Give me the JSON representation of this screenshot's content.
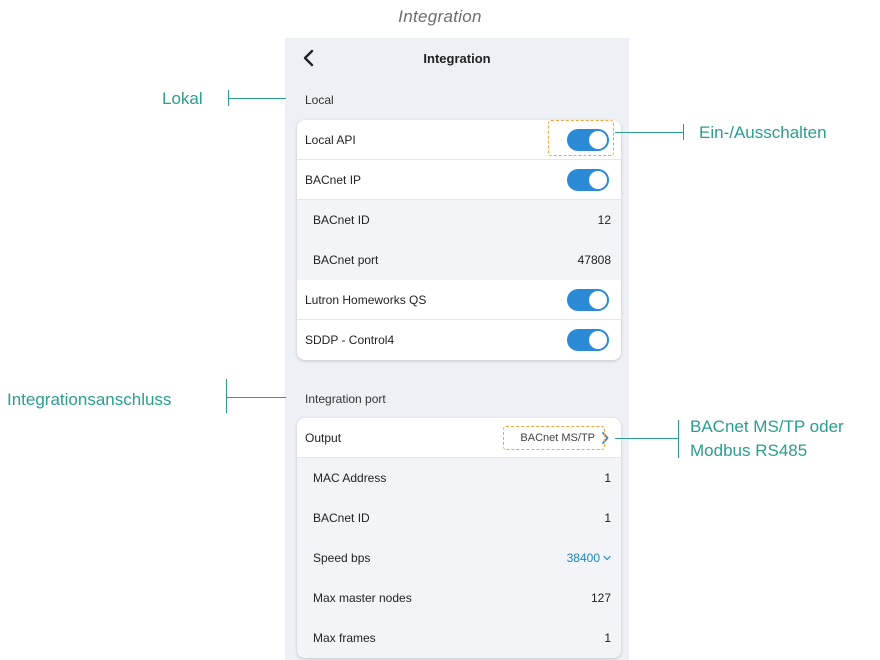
{
  "figure_title": "Integration",
  "screen": {
    "title": "Integration",
    "back_icon": "chevron-left-icon"
  },
  "local": {
    "section_label": "Local",
    "rows": [
      {
        "label": "Local API",
        "toggle": true
      },
      {
        "label": "BACnet IP",
        "toggle": true
      },
      {
        "label": "BACnet ID",
        "value": "12"
      },
      {
        "label": "BACnet port",
        "value": "47808"
      },
      {
        "label": "Lutron Homeworks QS",
        "toggle": true
      },
      {
        "label": "SDDP - Control4",
        "toggle": true
      }
    ]
  },
  "integration_port": {
    "section_label": "Integration port",
    "output": {
      "label": "Output",
      "value": "BACnet MS/TP"
    },
    "rows": [
      {
        "label": "MAC Address",
        "value": "1"
      },
      {
        "label": "BACnet ID",
        "value": "1"
      },
      {
        "label": "Speed bps",
        "value": "38400"
      },
      {
        "label": "Max master nodes",
        "value": "127"
      },
      {
        "label": "Max frames",
        "value": "1"
      }
    ]
  },
  "annotations": {
    "lokal": "Lokal",
    "ein_aus": "Ein-/Ausschalten",
    "integrationsanschluss": "Integrationsanschluss",
    "bacnet_modbus_line1": "BACnet MS/TP oder",
    "bacnet_modbus_line2": "Modbus RS485"
  },
  "colors": {
    "accent": "#2b8ad6",
    "annotation": "#2a9d8f",
    "highlight": "#f0a640"
  }
}
